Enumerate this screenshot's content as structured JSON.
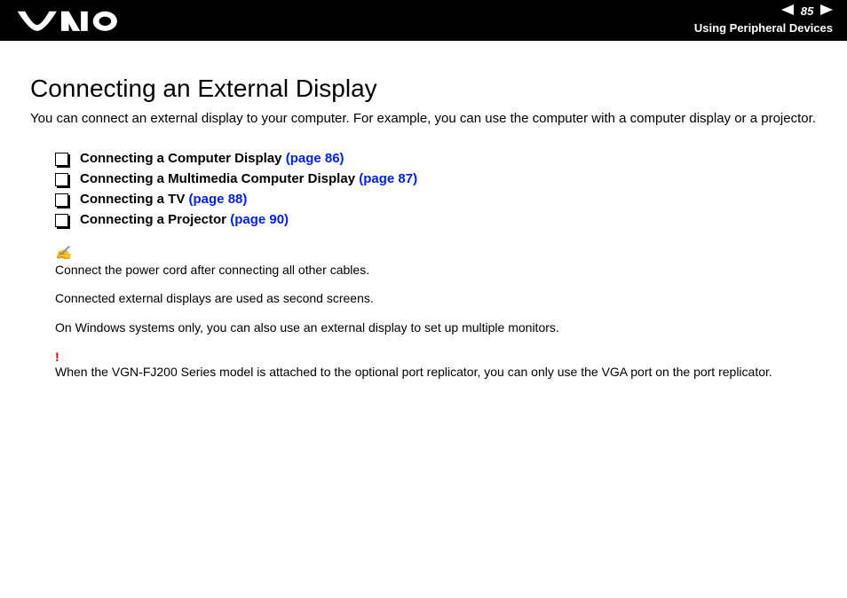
{
  "header": {
    "logo_alt": "VAIO",
    "page_number": "85",
    "section": "Using Peripheral Devices"
  },
  "title": "Connecting an External Display",
  "intro": "You can connect an external display to your computer. For example, you can use the computer with a computer display or a projector.",
  "toc": [
    {
      "label": "Connecting a Computer Display",
      "ref": "(page 86)"
    },
    {
      "label": "Connecting a Multimedia Computer Display",
      "ref": "(page 87)"
    },
    {
      "label": "Connecting a TV",
      "ref": "(page 88)"
    },
    {
      "label": "Connecting a Projector",
      "ref": "(page 90)"
    }
  ],
  "note_icon": "✍",
  "notes": [
    "Connect the power cord after connecting all other cables.",
    "Connected external displays are used as second screens.",
    "On Windows systems only, you can also use an external display to set up multiple monitors."
  ],
  "warn_icon": "!",
  "warning": "When the VGN-FJ200 Series model is attached to the optional port replicator, you can only use the VGA port on the port replicator."
}
